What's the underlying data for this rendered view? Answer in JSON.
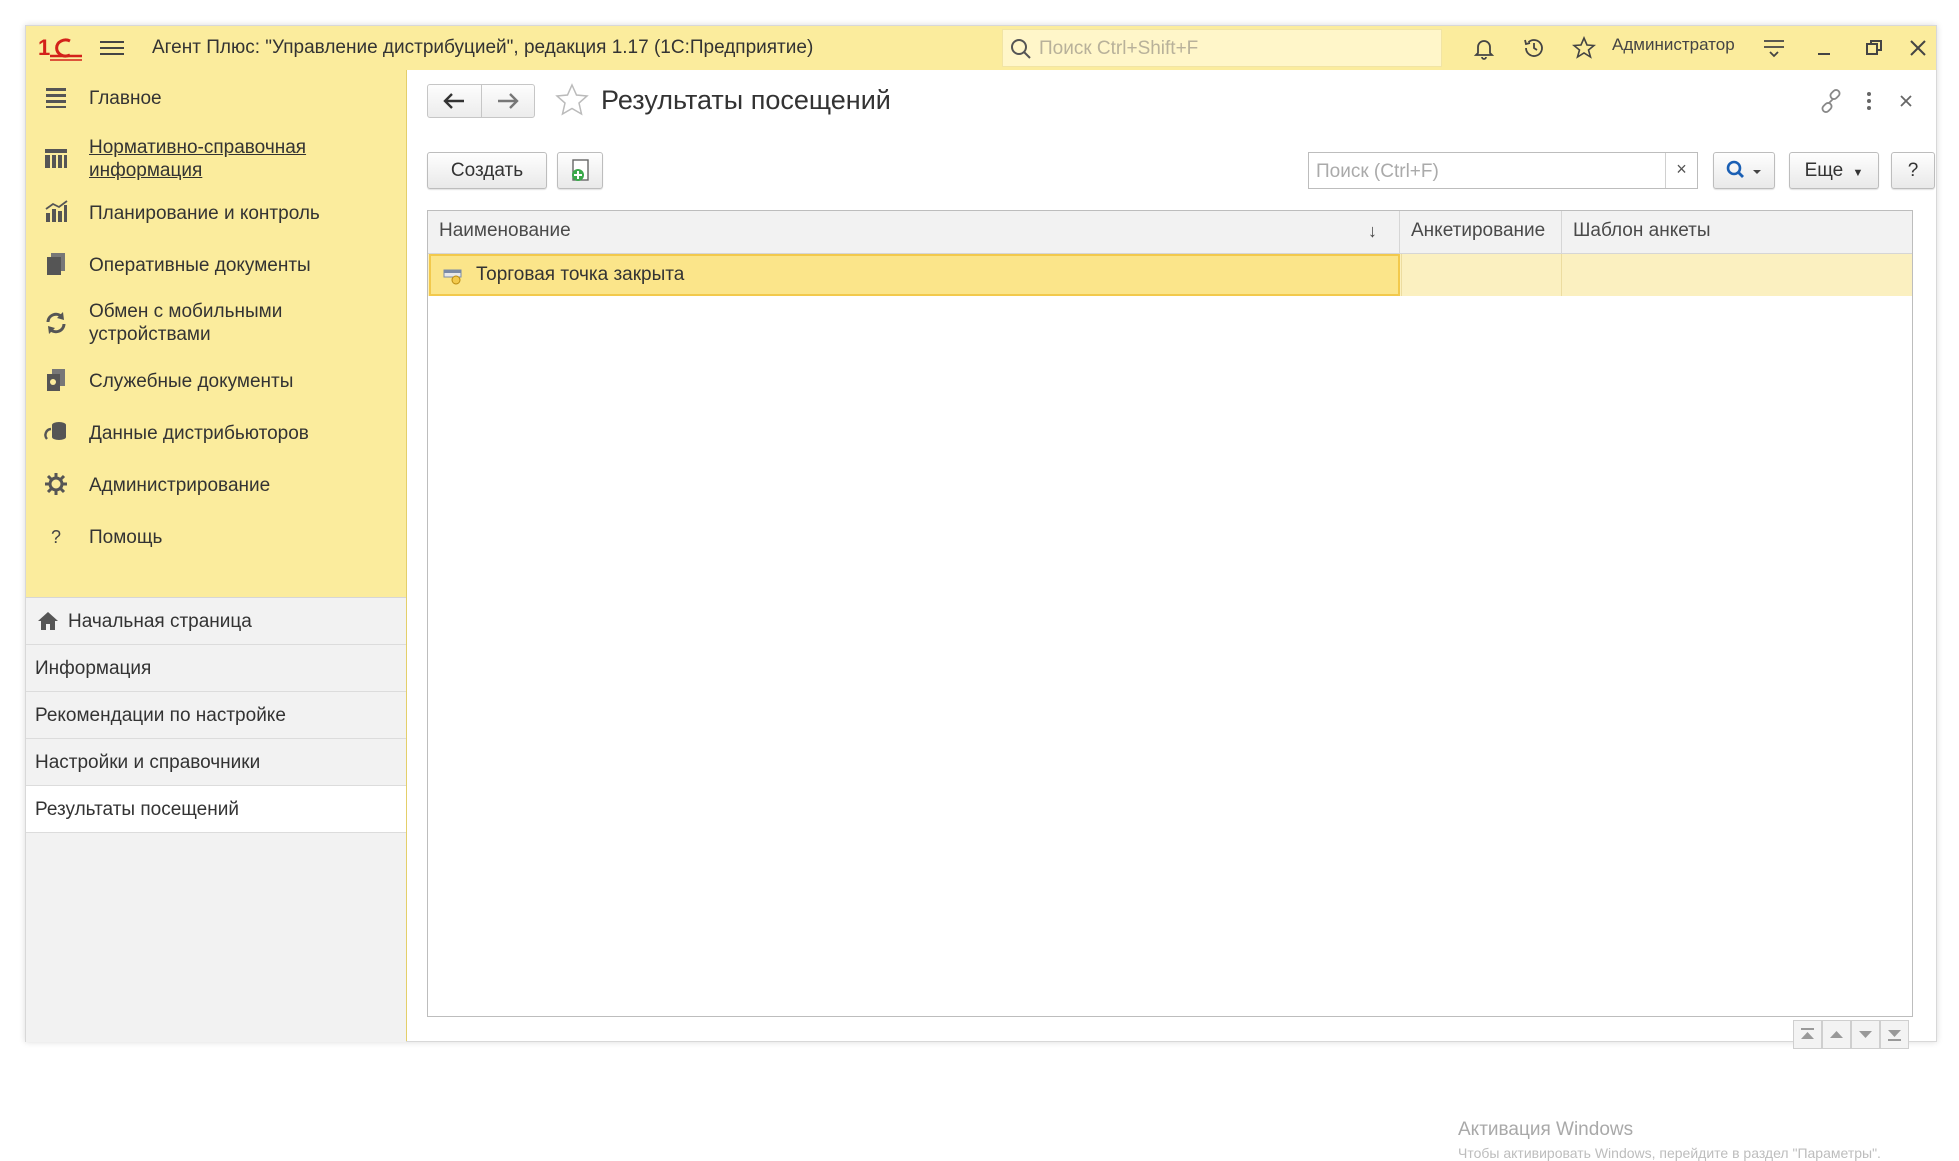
{
  "titlebar": {
    "app_title": "Агент Плюс: \"Управление дистрибуцией\", редакция 1.17  (1С:Предприятие)",
    "search_placeholder": "Поиск Ctrl+Shift+F",
    "user_name": "Администратор",
    "logo_color": "#d3211a"
  },
  "sidebar": {
    "sections": [
      {
        "label": "Главное",
        "icon": "list-icon"
      },
      {
        "label": "Нормативно-справочная информация",
        "icon": "catalog-icon"
      },
      {
        "label": "Планирование и контроль",
        "icon": "chart-icon"
      },
      {
        "label": "Оперативные документы",
        "icon": "documents-icon"
      },
      {
        "label": "Обмен с мобильными устройствами",
        "icon": "sync-icon"
      },
      {
        "label": "Служебные документы",
        "icon": "service-docs-icon"
      },
      {
        "label": "Данные дистрибьюторов",
        "icon": "distributor-icon"
      },
      {
        "label": "Администрирование",
        "icon": "gear-icon"
      },
      {
        "label": "Помощь",
        "icon": "help-icon"
      }
    ],
    "open_windows": [
      {
        "label": "Начальная страница"
      },
      {
        "label": "Информация"
      },
      {
        "label": "Рекомендации по настройке"
      },
      {
        "label": "Настройки и справочники"
      },
      {
        "label": "Результаты посещений"
      }
    ]
  },
  "form": {
    "title": "Результаты посещений",
    "create_label": "Создать",
    "search_placeholder": "Поиск (Ctrl+F)",
    "search_clear": "×",
    "more_label": "Еще",
    "help_label": "?"
  },
  "table": {
    "columns": [
      "Наименование",
      "Анкетирование",
      "Шаблон анкеты"
    ],
    "sort_indicator": "↓",
    "rows": [
      {
        "name": "Торговая точка закрыта",
        "survey": "",
        "template": ""
      }
    ]
  },
  "watermark": {
    "line1": "Активация Windows",
    "line2": "Чтобы активировать Windows, перейдите в раздел \"Параметры\"."
  },
  "colors": {
    "accent_yellow": "#fbec9d",
    "selected_row": "#fbe58a",
    "selection_border": "#f2c94c"
  }
}
